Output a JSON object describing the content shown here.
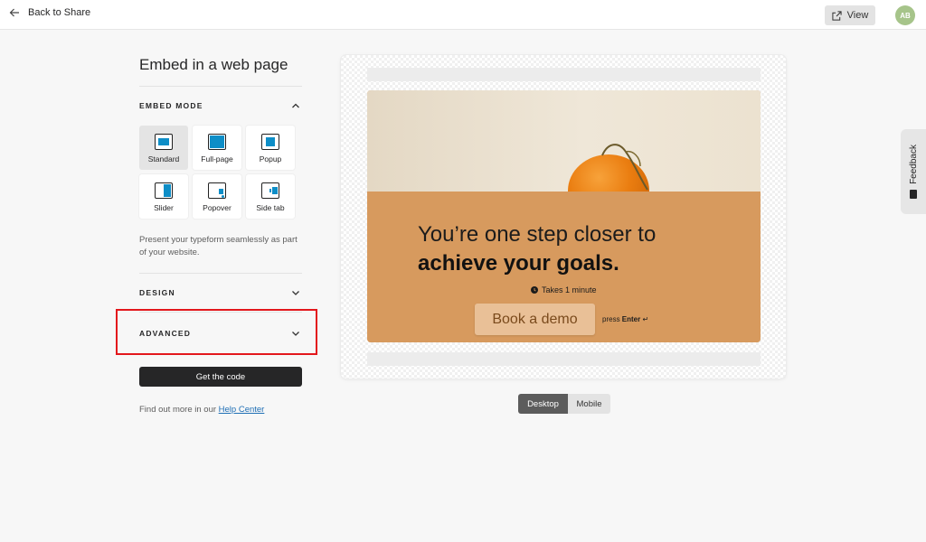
{
  "topbar": {
    "back_label": "Back to Share",
    "view_label": "View",
    "avatar_initials": "AB"
  },
  "panel": {
    "title": "Embed in a web page",
    "embed_mode_heading": "EMBED MODE",
    "modes": [
      {
        "label": "Standard",
        "icon": "standard-embed-icon",
        "selected": true
      },
      {
        "label": "Full-page",
        "icon": "full-page-embed-icon",
        "selected": false
      },
      {
        "label": "Popup",
        "icon": "popup-embed-icon",
        "selected": false
      },
      {
        "label": "Slider",
        "icon": "slider-embed-icon",
        "selected": false
      },
      {
        "label": "Popover",
        "icon": "popover-embed-icon",
        "selected": false
      },
      {
        "label": "Side tab",
        "icon": "side-tab-embed-icon",
        "selected": false
      }
    ],
    "description": "Present your typeform seamlessly as part of your website.",
    "design_heading": "DESIGN",
    "advanced_heading": "ADVANCED",
    "get_code_label": "Get the code",
    "help_prefix": "Find out more in our ",
    "help_link": "Help Center"
  },
  "preview": {
    "question_line1": "You’re one step closer to",
    "question_line2": "achieve your goals.",
    "takes_time": "Takes 1 minute",
    "button_label": "Book a demo",
    "press_text": "press",
    "enter_key": "Enter",
    "enter_symbol": "↵"
  },
  "device_toggle": {
    "desktop_label": "Desktop",
    "mobile_label": "Mobile",
    "selected": "Desktop"
  },
  "feedback_label": "Feedback",
  "colors": {
    "accent_blue": "#0e8ec7",
    "card_orange": "#d79a5e",
    "button_bg": "#e9c097",
    "highlight_red": "#e3171c"
  }
}
